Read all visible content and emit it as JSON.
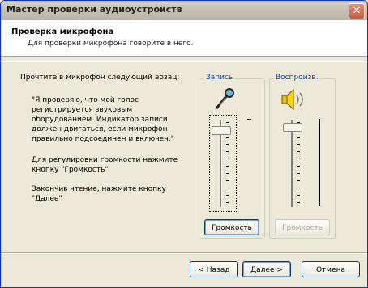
{
  "window": {
    "title": "Мастер проверки аудиоустройств"
  },
  "header": {
    "title": "Проверка микрофона",
    "subtitle": "Для проверки микрофона говорите в него."
  },
  "instructions": {
    "intro": "Прочтите в микрофон следующий абзац:",
    "quote_lines": [
      "\"Я проверяю, что мой голос",
      "регистрируется звуковым",
      "оборудованием. Индикатор записи",
      "должен двигаться, если микрофон",
      "правильно подсоединен и включен.\""
    ],
    "volume_hint_lines": [
      "Для регулировки громкости нажмите",
      "кнопку \"Громкость\""
    ],
    "finish_lines": [
      "Закончив чтение, нажмите кнопку",
      "\"Далее\""
    ]
  },
  "record": {
    "label": "Запись",
    "volume_button": "Громкость",
    "icon": "microphone-icon",
    "level": 0.92
  },
  "playback": {
    "label": "Воспроизв.",
    "volume_button": "Громкость",
    "icon": "speaker-icon",
    "level": 0.96
  },
  "buttons": {
    "back": "< Назад",
    "next": "Далее >",
    "cancel": "Отмена"
  },
  "colors": {
    "title_bar": "#c4bfb2",
    "close": "#c8553a",
    "accent": "#0046d5"
  }
}
